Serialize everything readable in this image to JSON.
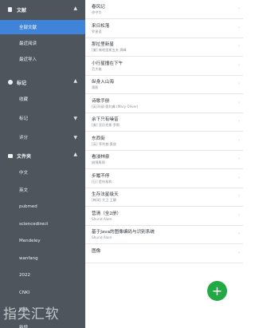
{
  "sidebar": {
    "documents": {
      "title": "文献"
    },
    "doc_items": [
      "全部文献",
      "最近阅读",
      "最近导入"
    ],
    "tags": {
      "title": "标记"
    },
    "tag_items": [
      "收藏",
      "标记",
      "评分"
    ],
    "library": {
      "title": "文件夹"
    },
    "library_items": [
      "中文",
      "英文",
      "pubmed",
      "sciencedirect",
      "Mendeley",
      "wanfang",
      "2022",
      "CNKI",
      "同步",
      "新增"
    ]
  },
  "list": {
    "rows": [
      {
        "title": "春风记",
        "sub": "徐中华"
      },
      {
        "title": "来日松落",
        "sub": "罗星语"
      },
      {
        "title": "那拉里新星",
        "sub": "[美] 席地里斯五夫 周峰"
      },
      {
        "title": "小行星撞在下午",
        "sub": "范大雄"
      },
      {
        "title": "纵身入山海",
        "sub": "落影"
      },
      {
        "title": "诗歌手册",
        "sub": "[英]玛丽·奥利弗 (Mary Oliver)"
      },
      {
        "title": "余下只有噪音",
        "sub": "[美] 亚历克斯·罗斯"
      },
      {
        "title": "东西街",
        "sub": "[英] 菲利普·桑兹"
      },
      {
        "title": "看浸林泉",
        "sub": "姚锦周周"
      },
      {
        "title": "步履不停",
        "sub": "[日] 是枝裕和"
      },
      {
        "title": "生存法星级天",
        "sub": "[韩]昭 大卫 王静"
      },
      {
        "title": "营清（全2册）",
        "sub": "Shurid Alam"
      },
      {
        "title": "基于Java的图像编码与识别系统",
        "sub": "Shurid Alam"
      },
      {
        "title": "图像",
        "sub": ""
      }
    ]
  },
  "fab": {
    "label": "+"
  },
  "watermark": {
    "text": "指尖汇软"
  },
  "colors": {
    "sidebar_bg": "#4e555c",
    "active_bg": "#3f84d8",
    "fab_bg": "#23a846"
  }
}
